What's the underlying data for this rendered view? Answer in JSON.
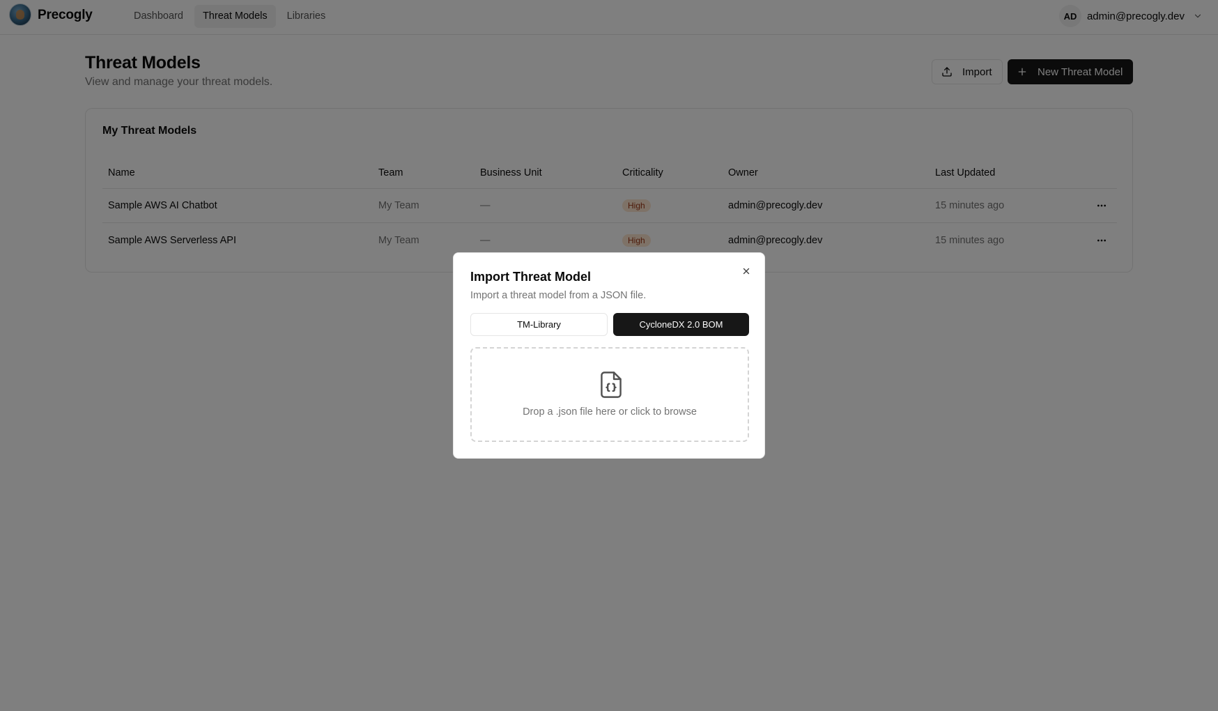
{
  "app": {
    "name": "Precogly"
  },
  "nav": {
    "items": [
      {
        "label": "Dashboard",
        "active": false
      },
      {
        "label": "Threat Models",
        "active": true
      },
      {
        "label": "Libraries",
        "active": false
      }
    ]
  },
  "user": {
    "initials": "AD",
    "email": "admin@precogly.dev"
  },
  "page": {
    "title": "Threat Models",
    "subtitle": "View and manage your threat models.",
    "import_label": "Import",
    "new_label": "New Threat Model"
  },
  "card": {
    "title": "My Threat Models",
    "columns": [
      "Name",
      "Team",
      "Business Unit",
      "Criticality",
      "Owner",
      "Last Updated"
    ],
    "rows": [
      {
        "name": "Sample AWS AI Chatbot",
        "team": "My Team",
        "business_unit": "—",
        "criticality": "High",
        "owner": "admin@precogly.dev",
        "last_updated": "15 minutes ago"
      },
      {
        "name": "Sample AWS Serverless API",
        "team": "My Team",
        "business_unit": "—",
        "criticality": "High",
        "owner": "admin@precogly.dev",
        "last_updated": "15 minutes ago"
      }
    ]
  },
  "dialog": {
    "title": "Import Threat Model",
    "description": "Import a threat model from a JSON file.",
    "tabs": [
      {
        "label": "TM-Library",
        "selected": false
      },
      {
        "label": "CycloneDX 2.0 BOM",
        "selected": true
      }
    ],
    "dropzone_text": "Drop a .json file here or click to browse"
  },
  "colors": {
    "primary_button": "#171717",
    "badge_high_bg": "#fde4cf",
    "badge_high_text": "#9a3412",
    "overlay": "rgba(0,0,0,0.5)"
  },
  "icons": [
    "upload-icon",
    "plus-icon",
    "more-horizontal-icon",
    "close-icon",
    "file-json-icon",
    "chevron-down-icon"
  ]
}
